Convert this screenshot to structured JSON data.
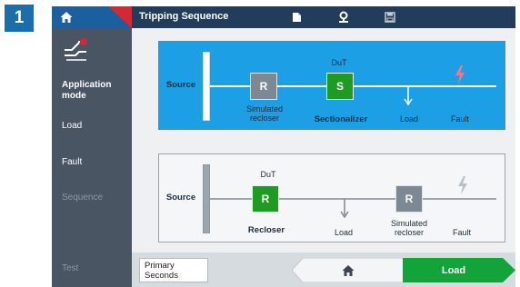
{
  "step_badge": "1",
  "topbar": {
    "title": "Tripping Sequence",
    "icons": [
      "home-icon",
      "folder-icon",
      "pin-icon",
      "save-icon"
    ]
  },
  "sidebar": {
    "mode_icon": "application-mode-icon",
    "items": [
      {
        "label": "Application mode",
        "state": "active"
      },
      {
        "label": "Load",
        "state": "normal"
      },
      {
        "label": "Fault",
        "state": "normal"
      },
      {
        "label": "Sequence",
        "state": "disabled"
      },
      {
        "label": "Test",
        "state": "disabled"
      }
    ]
  },
  "panel_sectionalizer": {
    "selected": true,
    "source_label": "Source",
    "recloser_symbol": "R",
    "recloser_label_line1": "Simulated",
    "recloser_label_line2": "recloser",
    "dut_label": "DuT",
    "dut_symbol": "S",
    "dut_name": "Sectionalizer",
    "load_label": "Load",
    "fault_label": "Fault"
  },
  "panel_recloser": {
    "selected": false,
    "source_label": "Source",
    "dut_label": "DuT",
    "dut_symbol": "R",
    "dut_name": "Recloser",
    "load_label": "Load",
    "recloser_symbol": "R",
    "recloser_label_line1": "Simulated",
    "recloser_label_line2": "recloser",
    "fault_label": "Fault"
  },
  "footer": {
    "units_line1": "Primary",
    "units_line2": "Seconds",
    "home_icon": "home-icon",
    "next_label": "Load"
  },
  "colors": {
    "topbar": "#223c5c",
    "sidebar": "#4a5563",
    "selected_panel": "#1d9fe6",
    "green": "#1f9a22",
    "grey_box": "#7c8893",
    "fault_active": "#f07a8a"
  }
}
